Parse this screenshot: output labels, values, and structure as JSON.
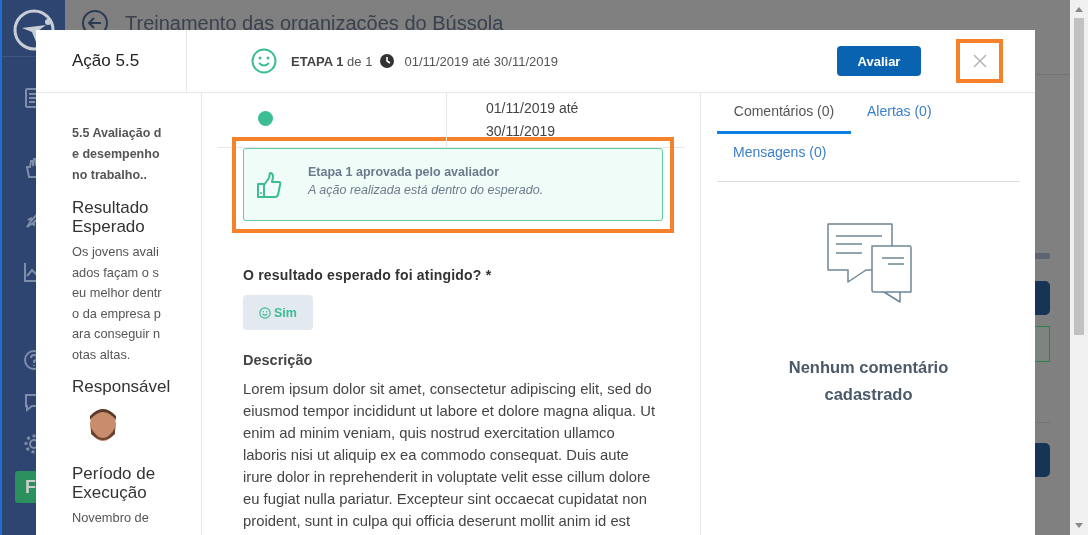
{
  "background": {
    "page_title": "Treinamento das organizações do Bússola",
    "sidebar_badge": "F"
  },
  "modal": {
    "title": "Ação 5.5",
    "stage": {
      "label": "ETAPA 1",
      "of": "de 1",
      "period": "01/11/2019 até 30/11/2019"
    },
    "evaluate_button": "Avaliar",
    "details": {
      "action_name": "5.5 Avaliação de desempenho no trabalho..",
      "expected_result_title": "Resultado Esperado",
      "expected_result": "Os jovens avaliados façam o seu melhor dentro da empresa para conseguir notas altas.",
      "responsible_title": "Responsável",
      "period_title": "Período de Execução",
      "period_text": "Novembro de"
    },
    "step": {
      "period": "01/11/2019 até 30/11/2019"
    },
    "approval": {
      "title": "Etapa 1 aprovada pelo avaliador",
      "message": "A ação realizada está dentro do esperado."
    },
    "question": {
      "label": "O resultado esperado foi atingido? *",
      "answer": "Sim"
    },
    "description": {
      "title": "Descrição",
      "text": "Lorem ipsum dolor sit amet, consectetur adipiscing elit, sed do eiusmod tempor incididunt ut labore et dolore magna aliqua. Ut enim ad minim veniam, quis nostrud exercitation ullamco laboris nisi ut aliquip ex ea commodo consequat. Duis aute irure dolor in reprehenderit in voluptate velit esse cillum dolore eu fugiat nulla pariatur. Excepteur sint occaecat cupidatat non proident, sunt in culpa qui officia deserunt mollit anim id est"
    },
    "tabs": [
      {
        "label": "Comentários (0)",
        "selected": true
      },
      {
        "label": "Alertas (0)",
        "selected": false
      },
      {
        "label": "Mensagens (0)",
        "selected": false
      }
    ],
    "empty_message": "Nenhum comentário cadastrado"
  }
}
